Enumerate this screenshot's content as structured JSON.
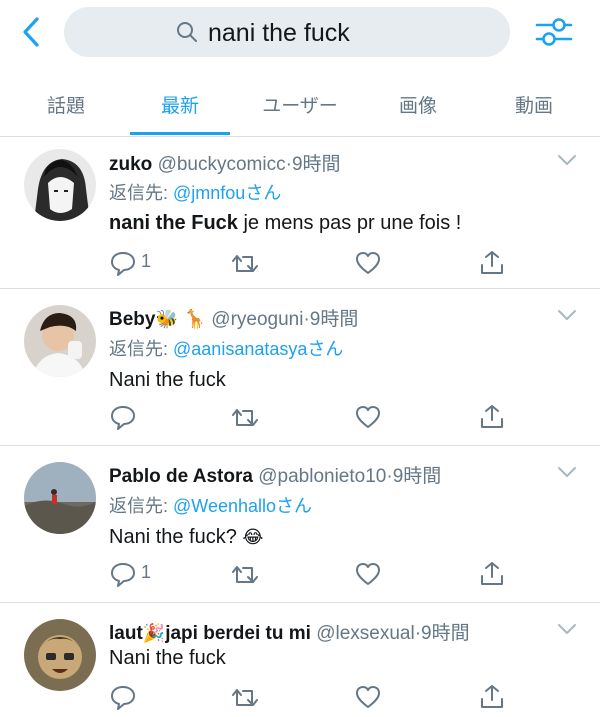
{
  "header": {
    "back_icon": "chevron-left-icon",
    "search_query": "nani the fuck",
    "search_icon": "search-icon",
    "filter_icon": "sliders-icon",
    "accent_color": "#1da1f2"
  },
  "tabs": [
    {
      "label": "話題",
      "active": false
    },
    {
      "label": "最新",
      "active": true
    },
    {
      "label": "ユーザー",
      "active": false
    },
    {
      "label": "画像",
      "active": false
    },
    {
      "label": "動画",
      "active": false
    }
  ],
  "tweets": [
    {
      "name": "zuko",
      "handle": "@buckycomicc",
      "time": "9時間",
      "reply_prefix": "返信先: ",
      "reply_to": "@jmnfou",
      "reply_suffix": "さん",
      "body_bold": "nani the Fuck",
      "body_rest": " je mens pas pr une fois !",
      "reply_count": "1"
    },
    {
      "name": "Beby",
      "name_emoji": "🐝 🦒",
      "handle": "@ryeoguni",
      "time": "9時間",
      "reply_prefix": "返信先: ",
      "reply_to": "@aanisanatasya",
      "reply_suffix": "さん",
      "body": "Nani the fuck",
      "reply_count": ""
    },
    {
      "name": "Pablo de Astora",
      "handle": "@pablonieto10",
      "time": "9時間",
      "reply_prefix": "返信先: ",
      "reply_to": "@Weenhallo",
      "reply_suffix": "さん",
      "body": "Nani the fuck?",
      "body_emoji": "😂",
      "reply_count": "1"
    },
    {
      "name": "laut",
      "name_emoji": "🎉",
      "name_rest": "japi berdei tu mi",
      "handle": "@lexsexual",
      "time": "9時間",
      "body": "Nani the fuck",
      "reply_count": ""
    }
  ],
  "separator": "·"
}
